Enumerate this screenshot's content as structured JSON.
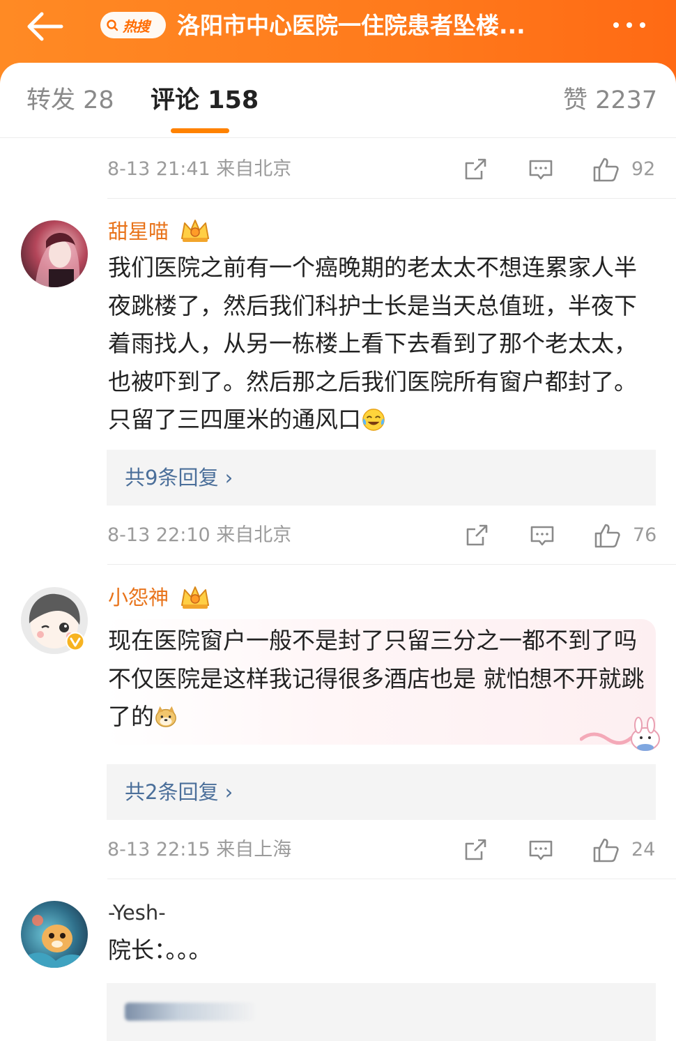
{
  "header": {
    "hot_tag": "热搜",
    "title": "洛阳市中心医院一住院患者坠楼...",
    "back_icon": "back-arrow-icon",
    "more_icon": "more-dots-icon"
  },
  "tabs": {
    "reposts": "转发 28",
    "comments": "评论 158",
    "likes": "赞 2237"
  },
  "colors": {
    "accent": "#ff8200",
    "username": "#e8731a",
    "link": "#4b6f9a"
  },
  "top_meta": {
    "time": "8-13 21:41  来自北京",
    "likes": "92"
  },
  "comments": [
    {
      "user": "甜星喵",
      "text": "我们医院之前有一个癌晚期的老太太不想连累家人半夜跳楼了，然后我们科护士长是当天总值班，半夜下着雨找人，从另一栋楼上看下去看到了那个老太太，也被吓到了。然后那之后我们医院所有窗户都封了。只留了三四厘米的通风口",
      "emoji": "crying-laughing-emoji",
      "replies": "共9条回复",
      "time": "8-13 22:10  来自北京",
      "likes": "76"
    },
    {
      "user": "小怨神",
      "text": "现在医院窗户一般不是封了只留三分之一都不到了吗 不仅医院是这样我记得很多酒店也是 就怕想不开就跳了的",
      "emoji": "doge-emoji",
      "replies": "共2条回复",
      "time": "8-13 22:15  来自上海",
      "likes": "24"
    },
    {
      "user": "-Yesh-",
      "text": "院长：。。。"
    }
  ]
}
